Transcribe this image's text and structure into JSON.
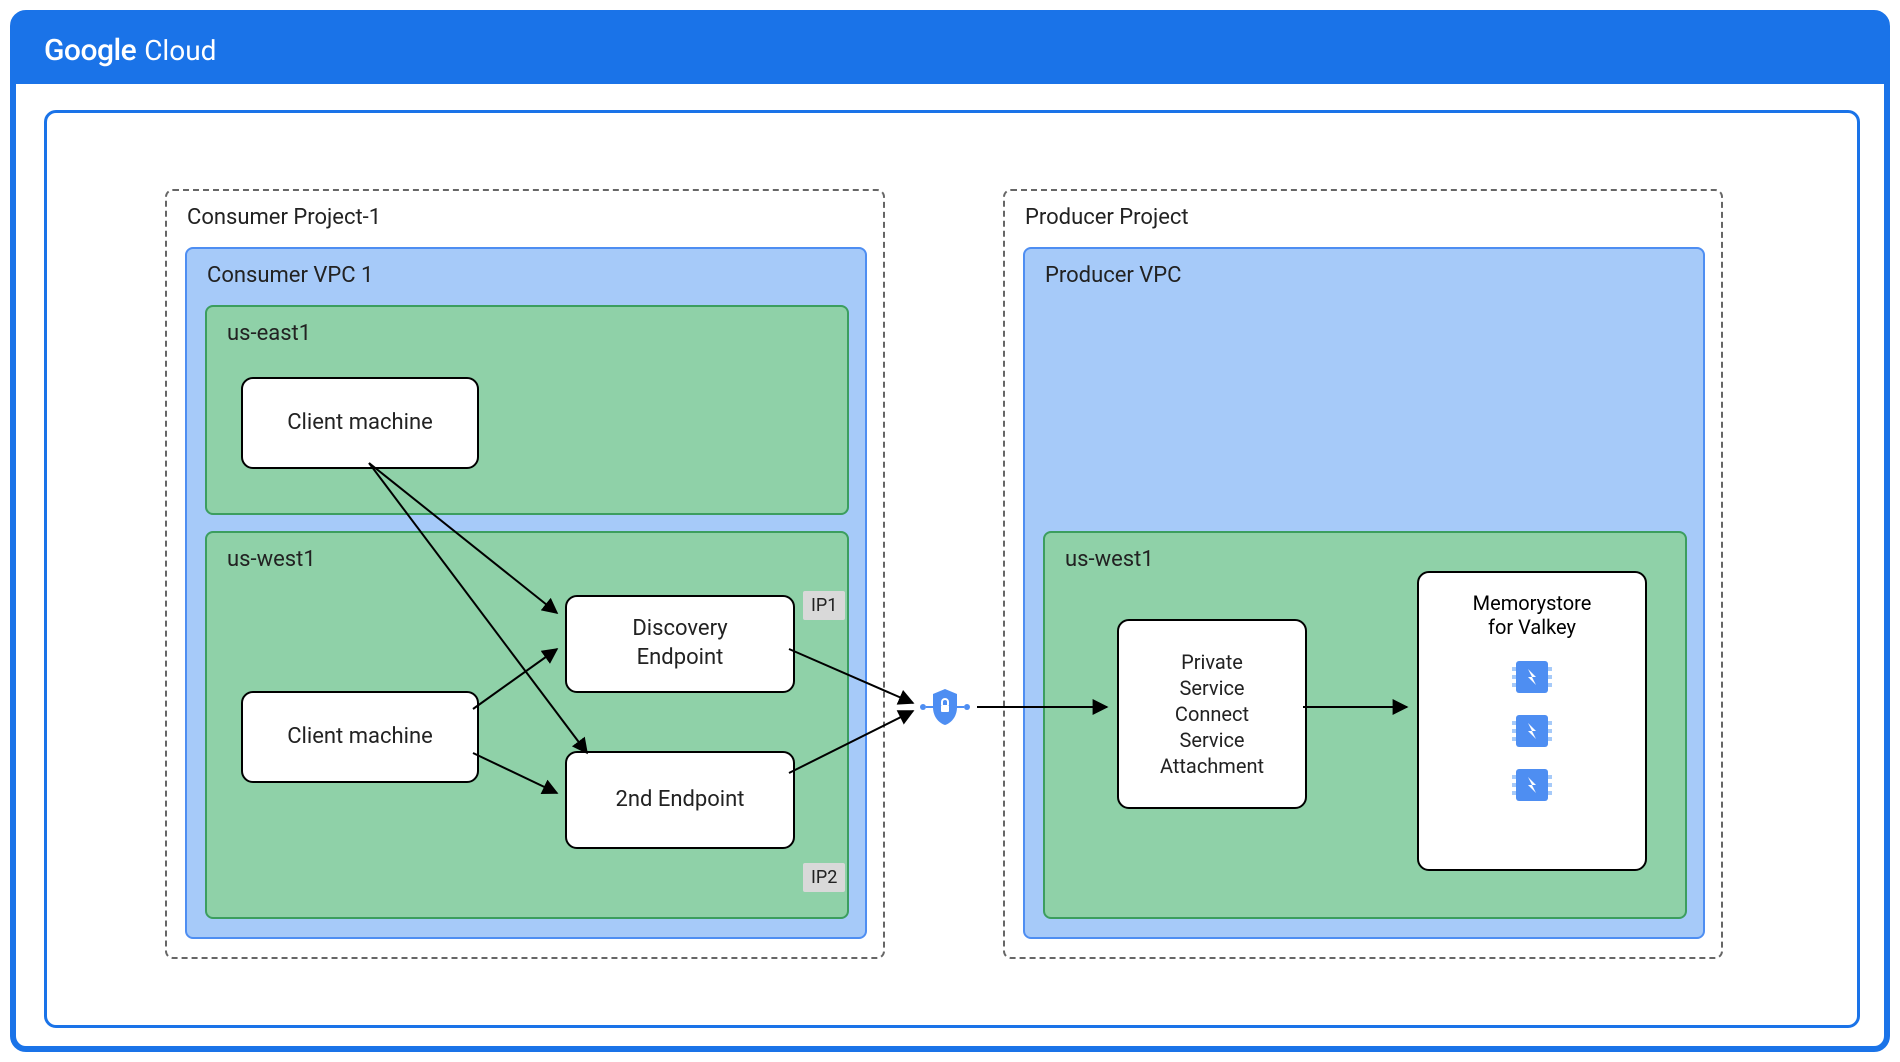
{
  "header": {
    "brand_left": "Google",
    "brand_right": "Cloud"
  },
  "consumer": {
    "project_label": "Consumer Project-1",
    "vpc_label": "Consumer VPC 1",
    "region_east": "us-east1",
    "region_west": "us-west1",
    "client_east": "Client machine",
    "client_west": "Client machine",
    "discovery_endpoint": "Discovery\nEndpoint",
    "second_endpoint": "2nd Endpoint",
    "ip1": "IP1",
    "ip2": "IP2"
  },
  "producer": {
    "project_label": "Producer Project",
    "vpc_label": "Producer VPC",
    "region_west": "us-west1",
    "psc_attachment": "Private\nService\nConnect\nService\nAttachment",
    "memorystore": "Memorystore\nfor Valkey"
  }
}
